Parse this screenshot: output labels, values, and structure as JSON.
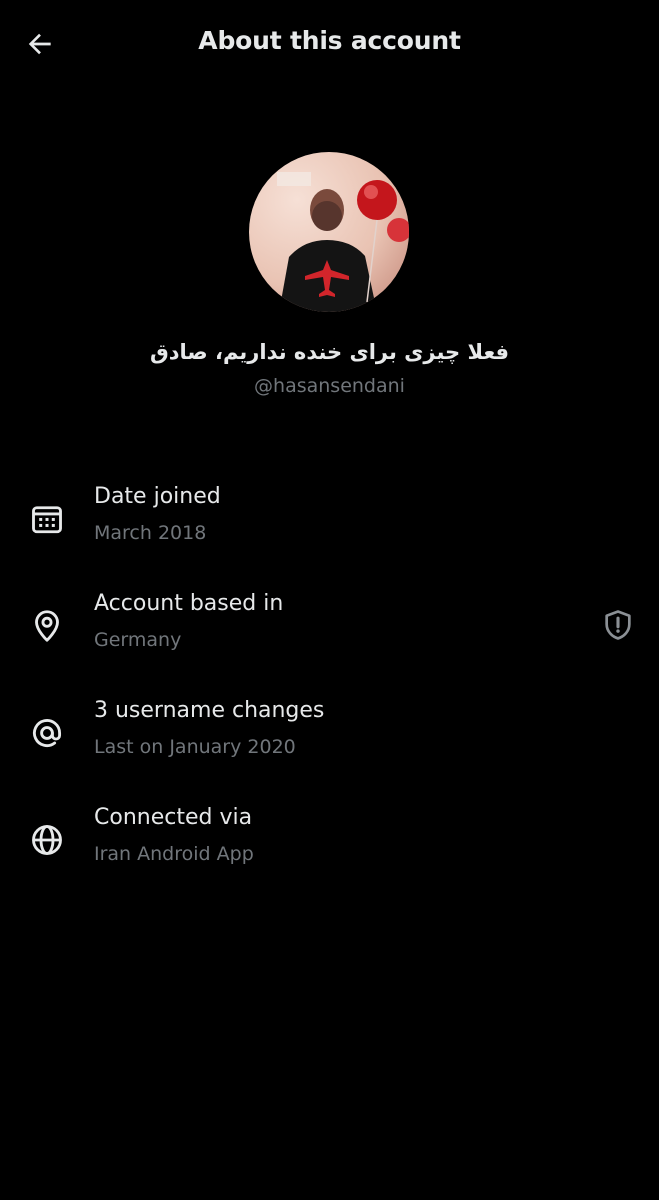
{
  "header": {
    "title": "About this account",
    "back_icon": "arrow-left-icon"
  },
  "profile": {
    "display_name": "فعلا چیزی برای خنده نداریم، صادق",
    "handle": "@hasansendani"
  },
  "details": [
    {
      "icon": "calendar-icon",
      "title": "Date joined",
      "subtitle": "March 2018"
    },
    {
      "icon": "location-pin-icon",
      "title": "Account based in",
      "subtitle": "Germany",
      "trailing_icon": "shield-alert-icon"
    },
    {
      "icon": "at-sign-icon",
      "title": "3 username changes",
      "subtitle": "Last on January 2020"
    },
    {
      "icon": "globe-icon",
      "title": "Connected via",
      "subtitle": "Iran Android App"
    }
  ],
  "colors": {
    "background": "#000000",
    "primary_text": "#e7e9ea",
    "secondary_text": "#71767b"
  }
}
